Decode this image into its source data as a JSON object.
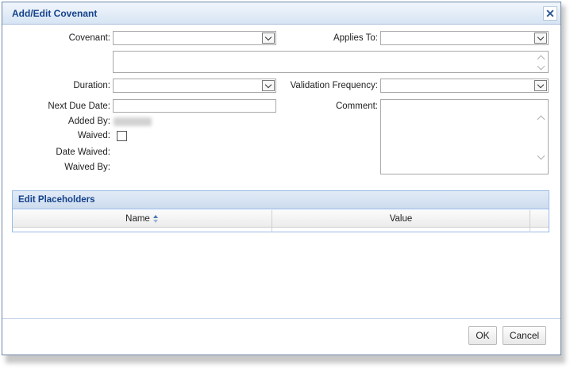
{
  "dialog": {
    "title": "Add/Edit Covenant"
  },
  "form": {
    "covenant_label": "Covenant:",
    "applies_to_label": "Applies To:",
    "duration_label": "Duration:",
    "validation_frequency_label": "Validation Frequency:",
    "next_due_date_label": "Next Due Date:",
    "comment_label": "Comment:",
    "added_by_label": "Added By:",
    "waived_label": "Waived:",
    "date_waived_label": "Date Waived:",
    "waived_by_label": "Waived By:"
  },
  "placeholders": {
    "title": "Edit Placeholders",
    "columns": [
      "Name",
      "Value"
    ]
  },
  "buttons": {
    "ok": "OK",
    "cancel": "Cancel"
  },
  "colors": {
    "title_text": "#15428b",
    "border": "#99bbe8"
  },
  "icons": {
    "close": "close-icon",
    "dropdown": "chevron-down-icon",
    "sort": "sort-icon"
  }
}
